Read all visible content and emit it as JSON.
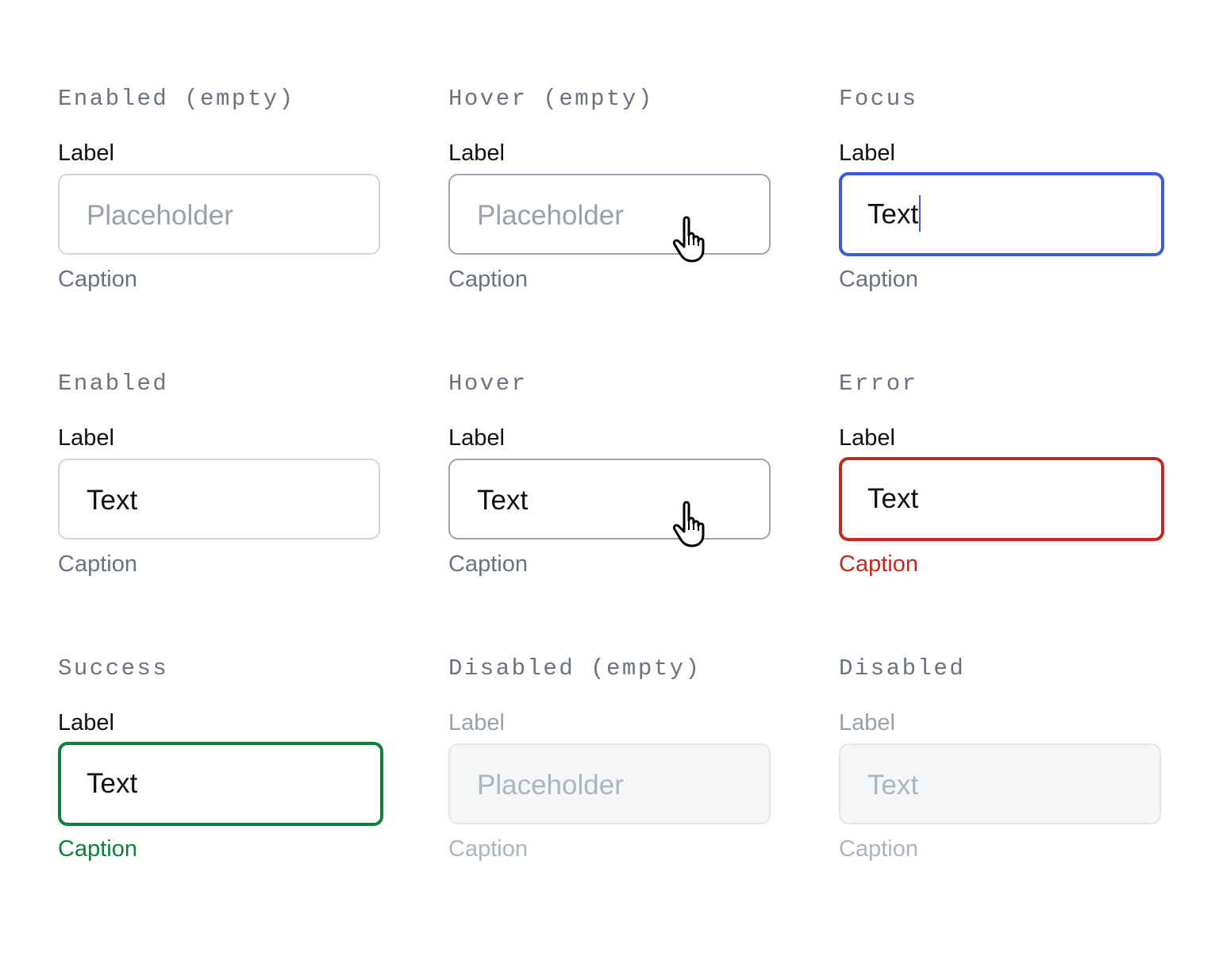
{
  "states": [
    {
      "title": "Enabled (empty)",
      "label": "Label",
      "value": "",
      "placeholder": "Placeholder",
      "caption": "Caption"
    },
    {
      "title": "Hover (empty)",
      "label": "Label",
      "value": "",
      "placeholder": "Placeholder",
      "caption": "Caption",
      "cursor": "pointer-hand-icon"
    },
    {
      "title": "Focus",
      "label": "Label",
      "value": "Text",
      "caption": "Caption",
      "border_color": "#3b5bd9"
    },
    {
      "title": "Enabled",
      "label": "Label",
      "value": "Text",
      "caption": "Caption"
    },
    {
      "title": "Hover",
      "label": "Label",
      "value": "Text",
      "caption": "Caption",
      "cursor": "pointer-hand-icon"
    },
    {
      "title": "Error",
      "label": "Label",
      "value": "Text",
      "caption": "Caption",
      "border_color": "#c4291c"
    },
    {
      "title": "Success",
      "label": "Label",
      "value": "Text",
      "caption": "Caption",
      "border_color": "#0f7f3a"
    },
    {
      "title": "Disabled (empty)",
      "label": "Label",
      "value": "",
      "placeholder": "Placeholder",
      "caption": "Caption"
    },
    {
      "title": "Disabled",
      "label": "Label",
      "value": "Text",
      "caption": "Caption"
    }
  ]
}
